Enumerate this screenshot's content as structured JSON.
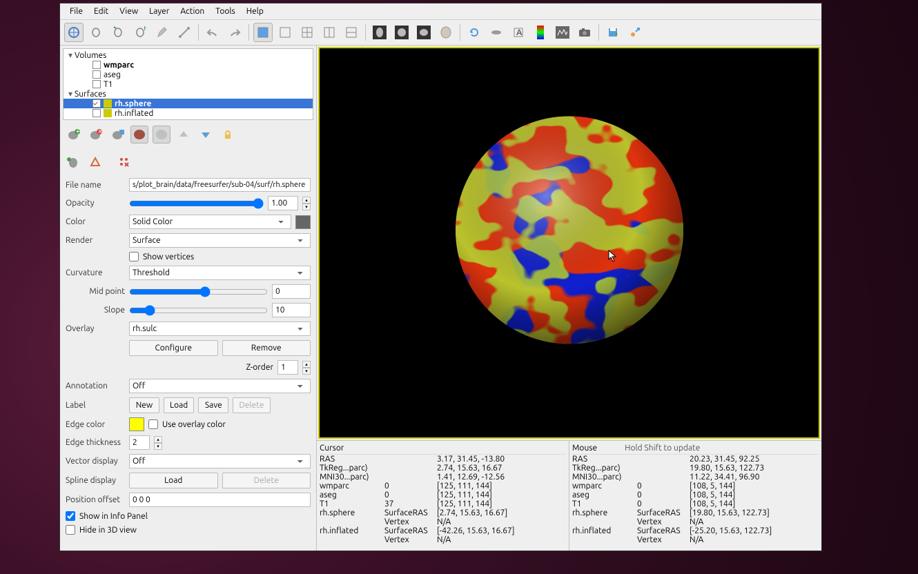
{
  "menu": [
    "File",
    "Edit",
    "View",
    "Layer",
    "Action",
    "Tools",
    "Help"
  ],
  "tree": {
    "groups": [
      {
        "label": "Volumes",
        "items": [
          {
            "label": "wmparc",
            "bold": true
          },
          {
            "label": "aseg"
          },
          {
            "label": "T1"
          }
        ]
      },
      {
        "label": "Surfaces",
        "items": [
          {
            "label": "rh.sphere",
            "color": "#cccc00",
            "checked": true,
            "selected": true,
            "bold": true
          },
          {
            "label": "rh.inflated",
            "color": "#cccc00"
          }
        ]
      }
    ]
  },
  "properties": {
    "file_name_label": "File name",
    "file_name": "s/plot_brain/data/freesurfer/sub-04/surf/rh.sphere",
    "opacity_label": "Opacity",
    "opacity": "1.00",
    "color_label": "Color",
    "color_mode": "Solid Color",
    "render_label": "Render",
    "render": "Surface",
    "show_vertices_label": "Show vertices",
    "curvature_label": "Curvature",
    "curvature": "Threshold",
    "midpoint_label": "Mid point",
    "midpoint": "0",
    "slope_label": "Slope",
    "slope": "10",
    "overlay_label": "Overlay",
    "overlay": "rh.sulc",
    "configure": "Configure",
    "remove": "Remove",
    "zorder_label": "Z-order",
    "zorder": "1",
    "annotation_label": "Annotation",
    "annotation": "Off",
    "label_label": "Label",
    "new": "New",
    "load": "Load",
    "save": "Save",
    "delete": "Delete",
    "edge_color_label": "Edge color",
    "use_overlay_color": "Use overlay color",
    "edge_thickness_label": "Edge thickness",
    "edge_thickness": "2",
    "vector_display_label": "Vector display",
    "vector_display": "Off",
    "spline_display_label": "Spline display",
    "spline_load": "Load",
    "spline_delete": "Delete",
    "position_offset_label": "Position offset",
    "position_offset": "0 0 0",
    "show_info_panel": "Show in Info Panel",
    "hide_3d": "Hide in 3D view"
  },
  "info": {
    "cursor": {
      "title": "Cursor",
      "rows": [
        [
          "RAS",
          "",
          "3.17, 31.45, -13.80"
        ],
        [
          "TkReg...parc)",
          "",
          "2.74, 15.63, 16.67"
        ],
        [
          "MNI30...parc)",
          "",
          "1.41, 12.69, -12.56"
        ],
        [
          "wmparc",
          "0",
          "[125, 111, 144]"
        ],
        [
          "aseg",
          "0",
          "[125, 111, 144]"
        ],
        [
          "T1",
          "37",
          "[125, 111, 144]"
        ],
        [
          "rh.sphere",
          "SurfaceRAS",
          "[2.74, 15.63, 16.67]"
        ],
        [
          "",
          "Vertex",
          "N/A"
        ],
        [
          "rh.inflated",
          "SurfaceRAS",
          "[-42.26, 15.63, 16.67]"
        ],
        [
          "",
          "Vertex",
          "N/A"
        ]
      ]
    },
    "mouse": {
      "title": "Mouse",
      "hint": "Hold Shift to update",
      "rows": [
        [
          "RAS",
          "",
          "20.23, 31.45, 92.25"
        ],
        [
          "TkReg...parc)",
          "",
          "19.80, 15.63, 122.73"
        ],
        [
          "MNI30...parc)",
          "",
          "11.22, 34.41, 96.90"
        ],
        [
          "wmparc",
          "0",
          "[108, 5, 144]"
        ],
        [
          "aseg",
          "0",
          "[108, 5, 144]"
        ],
        [
          "T1",
          "0",
          "[108, 5, 144]"
        ],
        [
          "rh.sphere",
          "SurfaceRAS",
          "[19.80, 15.63, 122.73]"
        ],
        [
          "",
          "Vertex",
          "N/A"
        ],
        [
          "rh.inflated",
          "SurfaceRAS",
          "[-25.20, 15.63, 122.73]"
        ],
        [
          "",
          "Vertex",
          "N/A"
        ]
      ]
    }
  }
}
